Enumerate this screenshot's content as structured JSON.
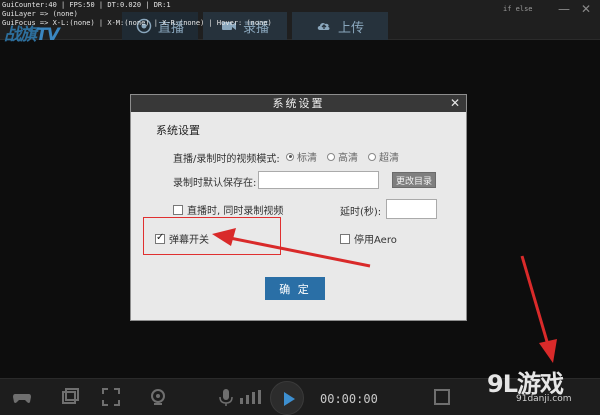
{
  "debug": {
    "line1": "GuiCounter:40 | FPS:50 | DT:0.020 | DR:1",
    "line2": "GuiLayer => (none)",
    "line3": "GuiFocus => X-L:(none) | X-M:(none) | X-R:(none) | Hover: (none)"
  },
  "logo": {
    "main": "战旗",
    "suffix": "TV"
  },
  "top_tabs": [
    {
      "label": "直播",
      "icon": "live-icon"
    },
    {
      "label": "录播",
      "icon": "record-icon"
    },
    {
      "label": "上传",
      "icon": "cloud-upload-icon"
    }
  ],
  "top_right_text": "if else",
  "dialog": {
    "title": "系统设置",
    "close": "✕",
    "section_title": "系统设置",
    "video_mode_label": "直播/录制时的视频模式:",
    "video_modes": [
      "标清",
      "高清",
      "超清"
    ],
    "video_mode_selected": "标清",
    "save_path_label": "录制时默认保存在:",
    "save_path_value": "",
    "browse_label": "更改目录",
    "record_while_live_label": "直播时, 同时录制视频",
    "record_while_live_checked": false,
    "delay_label": "延时(秒):",
    "delay_value": "",
    "danmaku_label": "弹幕开关",
    "danmaku_checked": true,
    "disable_aero_label": "停用Aero",
    "disable_aero_checked": false,
    "ok_label": "确 定"
  },
  "player": {
    "time": "00:00:00"
  },
  "watermark": {
    "main": "9L游戏",
    "sub": "91danji.com"
  },
  "colors": {
    "accent": "#2a6fa6",
    "annotation": "#e03030"
  }
}
